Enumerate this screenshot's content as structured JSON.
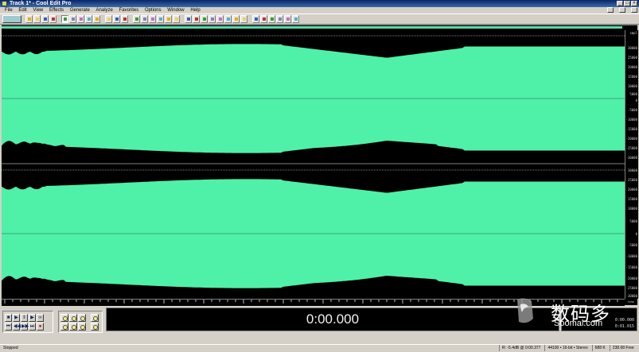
{
  "window": {
    "title": "Track 1* - Cool Edit Pro",
    "controls": [
      "_",
      "□",
      "×"
    ]
  },
  "menu": [
    "File",
    "Edit",
    "View",
    "Effects",
    "Generate",
    "Analyze",
    "Favorites",
    "Options",
    "Window",
    "Help"
  ],
  "toolbar": {
    "icons": [
      "mode-toggle-icon",
      "new-icon",
      "open-icon",
      "save-icon",
      "close-icon",
      "cut-icon",
      "copy-icon",
      "paste-icon",
      "paste-new-icon",
      "mix-paste-icon",
      "undo-icon",
      "redo-icon",
      "repeat-icon",
      "select-icon",
      "trim-icon",
      "silence-icon",
      "normalize-icon",
      "amplify-icon",
      "envelope-icon",
      "reverse-icon",
      "noise-icon",
      "eq-icon",
      "delay-icon",
      "reverb-icon",
      "stretch-icon",
      "pitch-icon",
      "tone-icon",
      "cd-icon",
      "cue-icon",
      "markers-icon",
      "info-icon",
      "settings-icon",
      "help-icon"
    ],
    "accent": "#4fe3a3"
  },
  "waveform": {
    "color": "#4ff0a8",
    "background": "#000000",
    "channels": [
      "left",
      "right"
    ]
  },
  "ruler": {
    "vertical_labels": [
      "smpl",
      "30000",
      "25000",
      "20000",
      "15000",
      "10000",
      "5000",
      "0",
      "-5000",
      "-10000",
      "-15000",
      "-20000",
      "-25000",
      "-30000"
    ],
    "unit": "hms"
  },
  "transport": {
    "buttons": [
      "stop",
      "play",
      "pause",
      "play-to-end",
      "loop",
      "go-start",
      "rewind",
      "fast-forward",
      "go-end",
      "record"
    ],
    "zoom_buttons": [
      "zoom-in-h",
      "zoom-out-h",
      "zoom-full",
      "zoom-in-v",
      "zoom-out-v",
      "zoom-sel",
      "zoom-left",
      "zoom-right",
      "zoom-v-full"
    ]
  },
  "time_display": "0:00.000",
  "selection_info": {
    "begin": "0:00.000",
    "length": "0:01.015"
  },
  "watermark": {
    "chinese": "数码多",
    "latin": "Soomal.com"
  },
  "status": {
    "state": "Stopped",
    "cells": [
      "R: -5.4dB @ 0:00.377",
      "44100 • 16-bit • Stereo",
      "688 K",
      "238.68 Free"
    ]
  }
}
